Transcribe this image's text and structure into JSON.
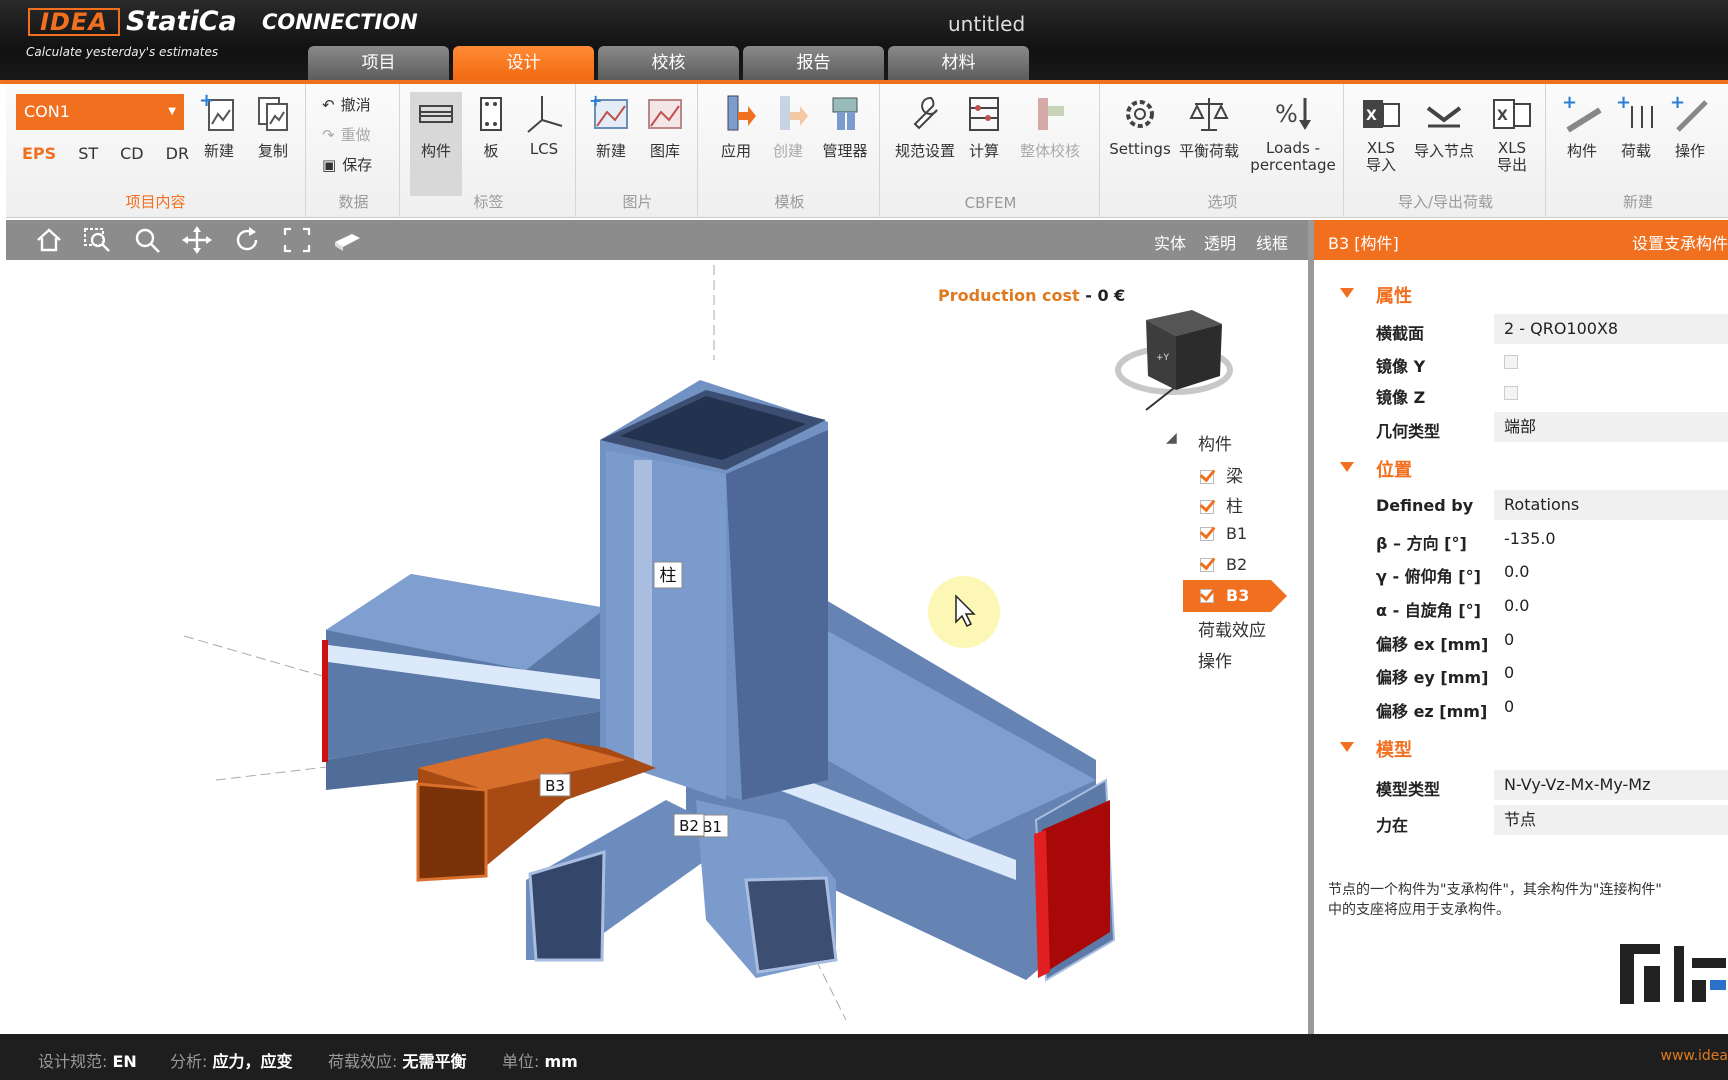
{
  "app": {
    "logo": "IDEA",
    "product": "StatiCa",
    "module": "CONNECTION",
    "tagline": "Calculate yesterday's estimates",
    "document_title": "untitled"
  },
  "tabs": [
    {
      "label": "项目",
      "active": false
    },
    {
      "label": "设计",
      "active": true
    },
    {
      "label": "校核",
      "active": false
    },
    {
      "label": "报告",
      "active": false
    },
    {
      "label": "材料",
      "active": false
    }
  ],
  "ribbon": {
    "project": {
      "connection_select": "CON1",
      "standards": [
        "EPS",
        "ST",
        "CD",
        "DR"
      ],
      "new_label": "新建",
      "copy_label": "复制",
      "group_label": "项目内容"
    },
    "data": {
      "undo": "撤消",
      "redo": "重做",
      "save": "保存",
      "group_label": "数据"
    },
    "labels": {
      "member": "构件",
      "plate": "板",
      "lcs": "LCS",
      "group_label": "标签"
    },
    "picture": {
      "new": "新建",
      "gallery": "图库",
      "group_label": "图片"
    },
    "template": {
      "apply": "应用",
      "create": "创建",
      "manager": "管理器",
      "group_label": "模板"
    },
    "cbfem": {
      "code_setup": "规范设置",
      "calculate": "计算",
      "overall_check": "整体校核",
      "group_label": "CBFEM"
    },
    "options": {
      "settings": "Settings",
      "balance": "平衡荷载",
      "loads_pct_1": "Loads -",
      "loads_pct_2": "percentage",
      "group_label": "选项"
    },
    "import_export": {
      "xls_import_1": "XLS",
      "xls_import_2": "导入",
      "import_node": "导入节点",
      "xls_export_1": "XLS",
      "xls_export_2": "导出",
      "group_label": "导入/导出荷载"
    },
    "new": {
      "member": "构件",
      "load": "荷载",
      "operation": "操作",
      "group_label": "新建"
    }
  },
  "view_toolbar": {
    "modes": [
      "实体",
      "透明",
      "线框"
    ]
  },
  "viewport": {
    "production_cost_label": "Production cost",
    "production_cost_sep": "-",
    "production_cost_value": "0 €",
    "member_labels": [
      "柱",
      "B3",
      "B2",
      "B1"
    ],
    "tree": {
      "root": "构件",
      "items": [
        "梁",
        "柱",
        "B1",
        "B2",
        "B3"
      ],
      "selected": "B3",
      "extra": [
        "荷载效应",
        "操作"
      ]
    }
  },
  "properties": {
    "header_left": "B3  [构件]",
    "header_right": "设置支承构件",
    "sections": {
      "attributes": "属性",
      "position": "位置",
      "model": "模型"
    },
    "rows": {
      "cross_section": {
        "label": "横截面",
        "value": "2 - QRO100X8"
      },
      "mirror_y": {
        "label": "镜像 Y"
      },
      "mirror_z": {
        "label": "镜像 Z"
      },
      "geometry_type": {
        "label": "几何类型",
        "value": "端部"
      },
      "defined_by": {
        "label": "Defined by",
        "value": "Rotations"
      },
      "beta": {
        "label": "β – 方向 [°]",
        "value": "-135.0"
      },
      "gamma": {
        "label": "γ - 俯仰角 [°]",
        "value": "0.0"
      },
      "alpha": {
        "label": "α - 自旋角 [°]",
        "value": "0.0"
      },
      "ex": {
        "label": "偏移 ex [mm]",
        "value": "0"
      },
      "ey": {
        "label": "偏移 ey [mm]",
        "value": "0"
      },
      "ez": {
        "label": "偏移 ez [mm]",
        "value": "0"
      },
      "model_type": {
        "label": "模型类型",
        "value": "N-Vy-Vz-Mx-My-Mz"
      },
      "forces_in": {
        "label": "力在",
        "value": "节点"
      }
    },
    "note_1": "节点的一个构件为\"支承构件\"，其余构件为\"连接构件\"",
    "note_2": "中的支座将应用于支承构件。"
  },
  "status_bar": {
    "code_label": "设计规范:",
    "code_value": "EN",
    "analysis_label": "分析:",
    "analysis_value": "应力，应变",
    "load_effect_label": "荷载效应:",
    "load_effect_value": "无需平衡",
    "unit_label": "单位:",
    "unit_value": "mm",
    "website": "www.idea"
  },
  "colors": {
    "accent": "#f07020",
    "member_blue": "#7b9ccc",
    "selected_member": "#c85a1a",
    "support_red": "#cc1010"
  }
}
